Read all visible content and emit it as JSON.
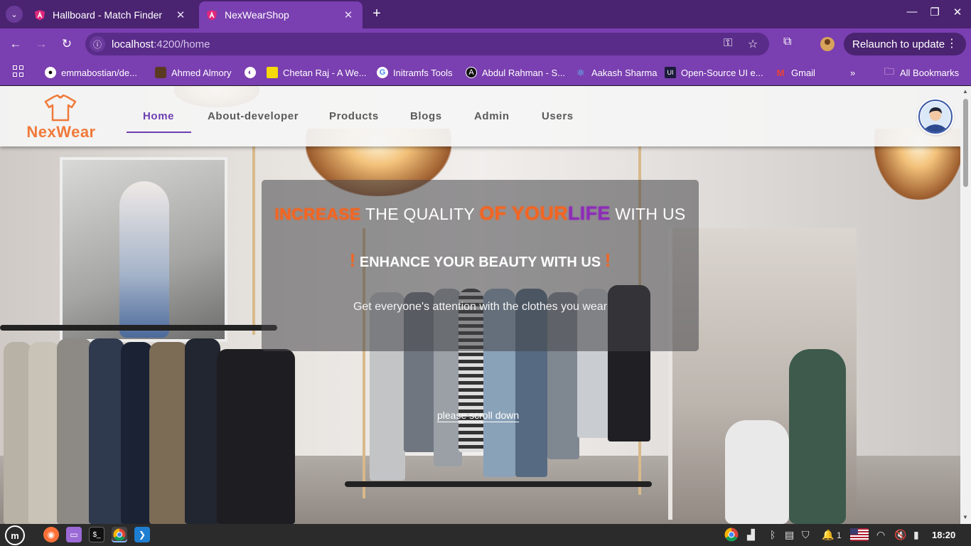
{
  "browser": {
    "tabs": [
      {
        "title": "Hallboard - Match Finder",
        "active": false
      },
      {
        "title": "NexWearShop",
        "active": true
      }
    ],
    "url_host": "localhost",
    "url_path": ":4200/home",
    "relaunch_label": "Relaunch to update",
    "bookmarks": [
      "emmabostian/de...",
      "Ahmed Almory",
      "Chetan Raj - A We...",
      "Initramfs Tools",
      "Abdul Rahman - S...",
      "Aakash Sharma",
      "Open-Source UI e...",
      "Gmail",
      "All Bookmarks"
    ]
  },
  "app": {
    "brand": "NexWear",
    "nav": [
      "Home",
      "About-developer",
      "Products",
      "Blogs",
      "Admin",
      "Users"
    ],
    "active_nav": "Home"
  },
  "hero": {
    "headline": {
      "part1": "INCREASE",
      "part2": " THE QUALITY ",
      "part3": "OF YOUR",
      "part4": "LIFE",
      "part5": " WITH US"
    },
    "subhead": {
      "bang": "!",
      "text": " ENHANCE YOUR BEAUTY WITH US "
    },
    "tagline": "Get everyone's attention with the clothes you wear",
    "scroll_link": "please scroll down"
  },
  "taskbar": {
    "clock": "18:20",
    "notification_count": "1"
  },
  "colors": {
    "accent_purple": "#6c3fb0",
    "brand_orange": "#f26522",
    "browser_purple": "#7a3fb0"
  }
}
